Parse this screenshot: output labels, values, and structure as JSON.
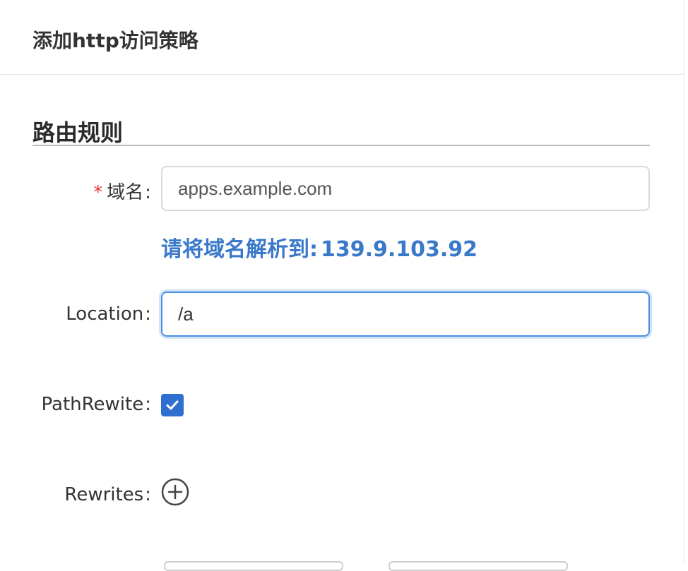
{
  "header": {
    "title": "添加http访问策略"
  },
  "section": {
    "title": "路由规则"
  },
  "form": {
    "domain": {
      "required_mark": "*",
      "label": "域名",
      "colon": ":",
      "placeholder": "apps.example.com",
      "value": ""
    },
    "hint": {
      "text": "请将域名解析到:",
      "ip": "139.9.103.92"
    },
    "location": {
      "label": "Location",
      "colon": ":",
      "value": "/a"
    },
    "path_rewrite": {
      "label": "PathRewite",
      "colon": ":",
      "checked": true
    },
    "rewrites": {
      "label": "Rewrites",
      "colon": ":",
      "icon": "plus-circle-icon"
    }
  },
  "colors": {
    "accent": "#2f6fd0",
    "hint": "#3a78c9",
    "required": "#e53935"
  }
}
